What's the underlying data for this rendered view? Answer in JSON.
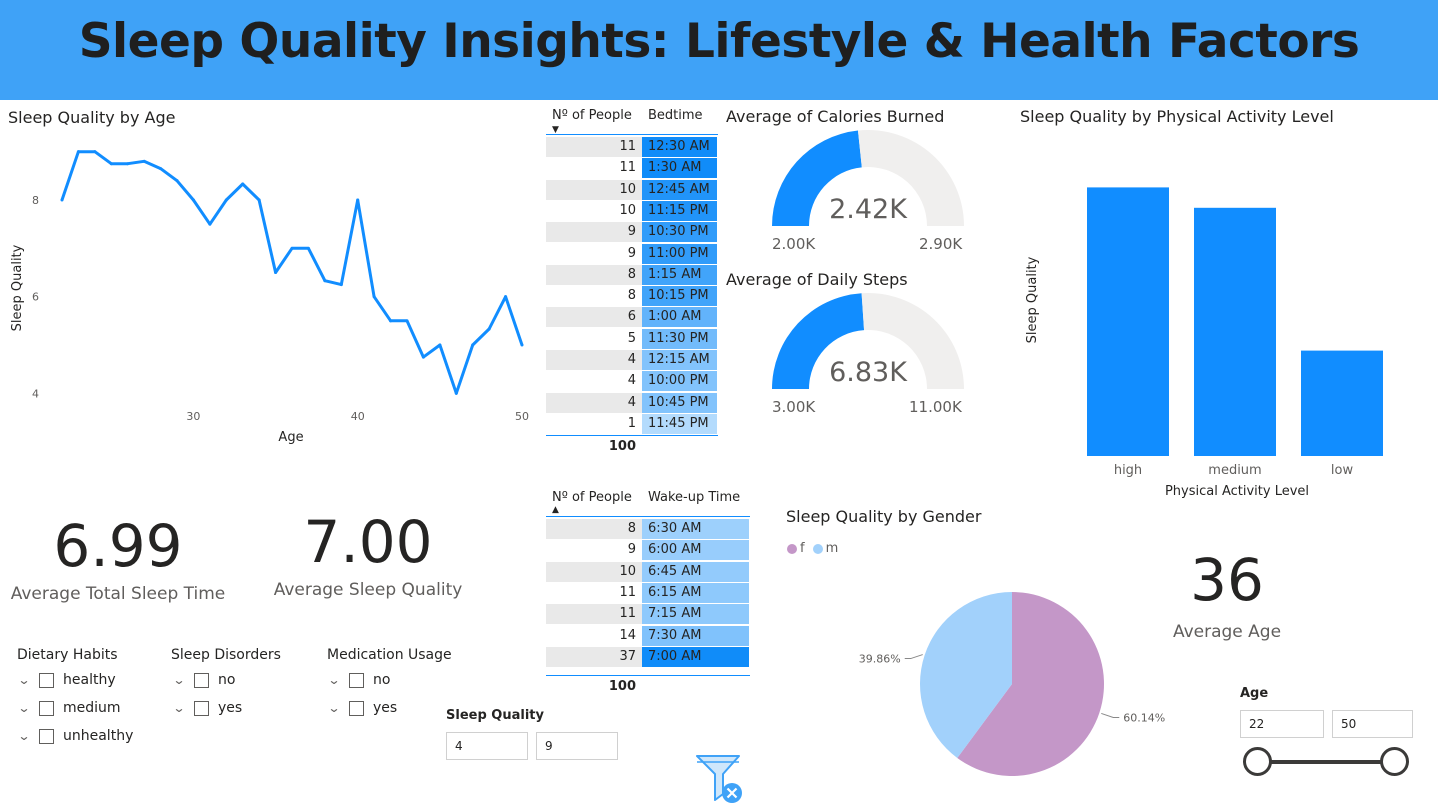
{
  "header": {
    "title": "Sleep Quality Insights: Lifestyle & Health Factors"
  },
  "line_chart": {
    "title": "Sleep Quality by Age",
    "xlabel": "Age",
    "ylabel": "Sleep Quality",
    "x_ticks": [
      "30",
      "40",
      "50"
    ],
    "y_ticks": [
      "4",
      "6",
      "8"
    ],
    "color": "#118dff"
  },
  "bedtime_table": {
    "col1": "Nº of People",
    "col2": "Bedtime",
    "rows": [
      {
        "n": "11",
        "t": "12:30 AM",
        "v": 11
      },
      {
        "n": "11",
        "t": "1:30 AM",
        "v": 11
      },
      {
        "n": "10",
        "t": "12:45 AM",
        "v": 10
      },
      {
        "n": "10",
        "t": "11:15 PM",
        "v": 10
      },
      {
        "n": "9",
        "t": "10:30 PM",
        "v": 9
      },
      {
        "n": "9",
        "t": "11:00 PM",
        "v": 9
      },
      {
        "n": "8",
        "t": "1:15 AM",
        "v": 8
      },
      {
        "n": "8",
        "t": "10:15 PM",
        "v": 8
      },
      {
        "n": "6",
        "t": "1:00 AM",
        "v": 6
      },
      {
        "n": "5",
        "t": "11:30 PM",
        "v": 5
      },
      {
        "n": "4",
        "t": "12:15 AM",
        "v": 4
      },
      {
        "n": "4",
        "t": "10:00 PM",
        "v": 4
      },
      {
        "n": "4",
        "t": "10:45 PM",
        "v": 4
      },
      {
        "n": "1",
        "t": "11:45 PM",
        "v": 1
      }
    ],
    "total": "100"
  },
  "wakeup_table": {
    "col1": "Nº of People",
    "col2": "Wake-up Time",
    "rows": [
      {
        "n": "8",
        "t": "6:30 AM",
        "v": 8
      },
      {
        "n": "9",
        "t": "6:00 AM",
        "v": 9
      },
      {
        "n": "10",
        "t": "6:45 AM",
        "v": 10
      },
      {
        "n": "11",
        "t": "6:15 AM",
        "v": 11
      },
      {
        "n": "11",
        "t": "7:15 AM",
        "v": 11
      },
      {
        "n": "14",
        "t": "7:30 AM",
        "v": 14
      },
      {
        "n": "37",
        "t": "7:00 AM",
        "v": 37
      }
    ],
    "total": "100"
  },
  "gauge_calories": {
    "title": "Average of Calories Burned",
    "value_label": "2.42K",
    "min_label": "2.00K",
    "max_label": "2.90K",
    "value": 2420,
    "min": 2000,
    "max": 2900
  },
  "gauge_steps": {
    "title": "Average of Daily Steps",
    "value_label": "6.83K",
    "min_label": "3.00K",
    "max_label": "11.00K",
    "value": 6830,
    "min": 3000,
    "max": 11000
  },
  "bar_chart": {
    "title": "Sleep Quality by Physical Activity Level",
    "xlabel": "Physical Activity Level",
    "ylabel": "Sleep Quality",
    "color": "#118dff"
  },
  "kpis": {
    "sleep_time_value": "6.99",
    "sleep_time_label": "Average Total Sleep Time",
    "sleep_quality_value": "7.00",
    "sleep_quality_label": "Average Sleep Quality",
    "age_value": "36",
    "age_label": "Average Age"
  },
  "pie_chart": {
    "title": "Sleep Quality by Gender",
    "legend": [
      {
        "label": "f",
        "color": "#c497c8"
      },
      {
        "label": "m",
        "color": "#a2d1fb"
      }
    ]
  },
  "slicers": {
    "dietary": {
      "title": "Dietary Habits",
      "items": [
        "healthy",
        "medium",
        "unhealthy"
      ]
    },
    "disorders": {
      "title": "Sleep Disorders",
      "items": [
        "no",
        "yes"
      ]
    },
    "medication": {
      "title": "Medication Usage",
      "items": [
        "no",
        "yes"
      ]
    }
  },
  "sleep_quality_range": {
    "title": "Sleep Quality",
    "min": "4",
    "max": "9"
  },
  "age_range": {
    "title": "Age",
    "min": "22",
    "max": "50"
  },
  "icons": {
    "filter": "clear-filter-icon"
  },
  "chart_data": [
    {
      "type": "line",
      "title": "Sleep Quality by Age",
      "xlabel": "Age",
      "ylabel": "Sleep Quality",
      "x": [
        22,
        23,
        24,
        25,
        26,
        27,
        28,
        29,
        30,
        31,
        32,
        33,
        34,
        35,
        36,
        37,
        38,
        39,
        40,
        41,
        42,
        43,
        44,
        45,
        46,
        47,
        48,
        49,
        50
      ],
      "values": [
        8.0,
        9.0,
        9.0,
        8.75,
        8.75,
        8.8,
        8.65,
        8.4,
        8.0,
        7.5,
        8.0,
        8.33,
        8.0,
        6.5,
        7.0,
        7.0,
        6.33,
        6.25,
        8.0,
        6.0,
        5.5,
        5.5,
        4.75,
        5.0,
        4.0,
        5.0,
        5.33,
        6.0,
        5.0
      ],
      "xlim": [
        22,
        50
      ],
      "ylim": [
        3.8,
        9.2
      ]
    },
    {
      "type": "bar",
      "title": "Sleep Quality by Physical Activity Level",
      "xlabel": "Physical Activity Level",
      "ylabel": "Sleep Quality",
      "categories": [
        "high",
        "medium",
        "low"
      ],
      "values": [
        7.9,
        7.3,
        3.1
      ],
      "ylim": [
        0,
        9
      ]
    },
    {
      "type": "pie",
      "title": "Sleep Quality by Gender",
      "categories": [
        "f",
        "m"
      ],
      "values": [
        60.14,
        39.86
      ],
      "labels": [
        "60.14%",
        "39.86%"
      ]
    }
  ]
}
